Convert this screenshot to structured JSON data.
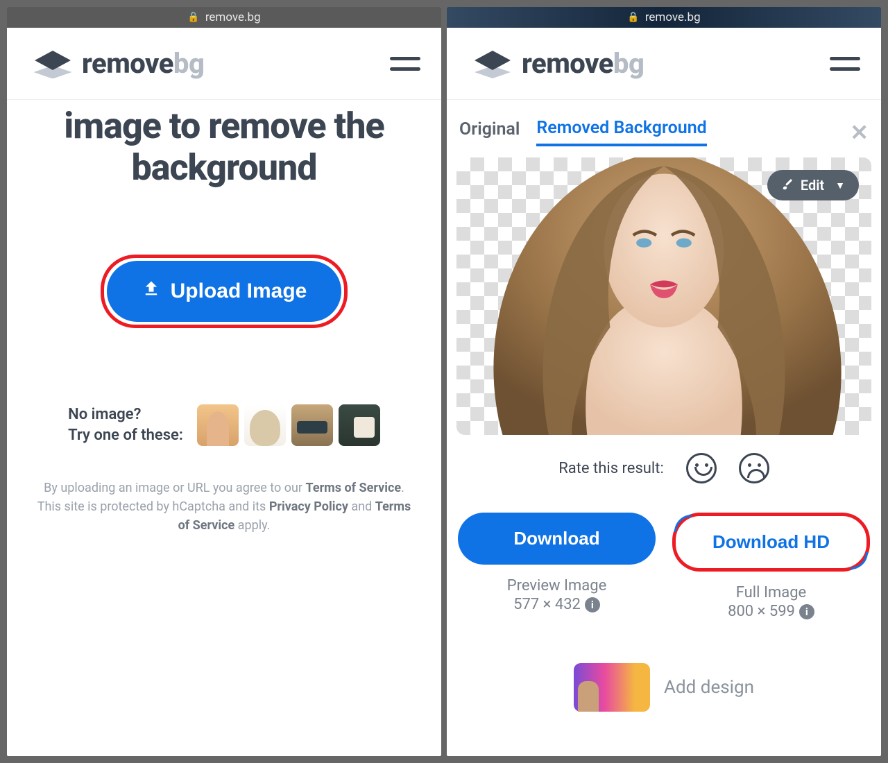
{
  "url": "remove.bg",
  "logo": {
    "main": "remove",
    "suffix": "bg"
  },
  "left": {
    "hero": "image to remove the background",
    "upload_label": "Upload Image",
    "try_line1": "No image?",
    "try_line2": "Try one of these:",
    "legal_pre": "By uploading an image or URL you agree to our ",
    "legal_tos": "Terms of Service",
    "legal_mid1": ". This site is protected by hCaptcha and its ",
    "legal_pp": "Privacy Policy",
    "legal_mid2": " and ",
    "legal_tos2": "Terms of Service",
    "legal_post": " apply."
  },
  "right": {
    "tab_original": "Original",
    "tab_removed": "Removed Background",
    "edit_label": "Edit",
    "rate_label": "Rate this result:",
    "download_label": "Download",
    "download_hd_label": "Download HD",
    "preview_title": "Preview Image",
    "preview_dims": "577 × 432",
    "full_title": "Full Image",
    "full_dims": "800 × 599",
    "add_design": "Add design"
  }
}
